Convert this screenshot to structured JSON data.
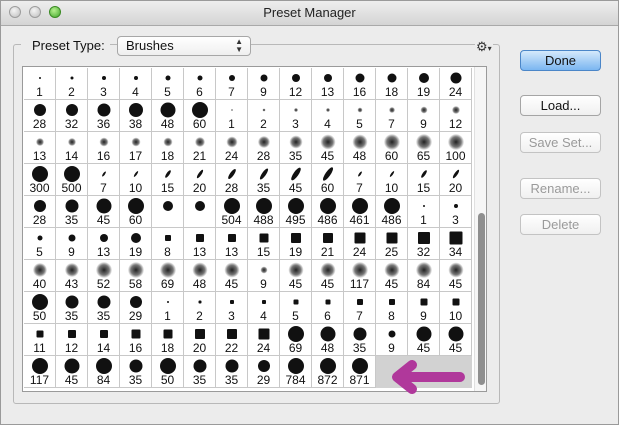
{
  "window": {
    "title": "Preset Manager"
  },
  "preset_type": {
    "label": "Preset Type:",
    "value": "Brushes"
  },
  "gear": {
    "icon": "gear-icon",
    "glyph": "⚙"
  },
  "buttons": {
    "done": "Done",
    "load": "Load...",
    "save_set": "Save Set...",
    "rename": "Rename...",
    "delete": "Delete"
  },
  "brush_sizes": [
    [
      "1",
      "2",
      "3",
      "4",
      "5",
      "6",
      "7",
      "9",
      "12",
      "13",
      "16",
      "18",
      "19",
      "24"
    ],
    [
      "28",
      "32",
      "36",
      "38",
      "48",
      "60",
      "1",
      "2",
      "3",
      "4",
      "5",
      "7",
      "9",
      "12"
    ],
    [
      "13",
      "14",
      "16",
      "17",
      "18",
      "21",
      "24",
      "28",
      "35",
      "45",
      "48",
      "60",
      "65",
      "100"
    ],
    [
      "300",
      "500",
      "7",
      "10",
      "15",
      "20",
      "28",
      "35",
      "45",
      "60",
      "7",
      "10",
      "15",
      "20"
    ],
    [
      "28",
      "35",
      "45",
      "60",
      "",
      "",
      "504",
      "488",
      "495",
      "486",
      "461",
      "486",
      "1",
      "3"
    ],
    [
      "5",
      "9",
      "13",
      "19",
      "8",
      "13",
      "13",
      "15",
      "19",
      "21",
      "24",
      "25",
      "32",
      "34"
    ],
    [
      "40",
      "43",
      "52",
      "58",
      "69",
      "48",
      "45",
      "9",
      "45",
      "45",
      "117",
      "45",
      "84",
      "45"
    ],
    [
      "50",
      "35",
      "35",
      "29",
      "1",
      "2",
      "3",
      "4",
      "5",
      "6",
      "7",
      "8",
      "9",
      "10"
    ],
    [
      "11",
      "12",
      "14",
      "16",
      "18",
      "20",
      "22",
      "24",
      "69",
      "48",
      "35",
      "9",
      "45",
      "45"
    ],
    [
      "117",
      "45",
      "84",
      "35",
      "50",
      "35",
      "35",
      "29",
      "784",
      "872",
      "871"
    ]
  ],
  "colors": {
    "accent": "#4b86c8",
    "annotation_arrow": "#b0389b"
  }
}
